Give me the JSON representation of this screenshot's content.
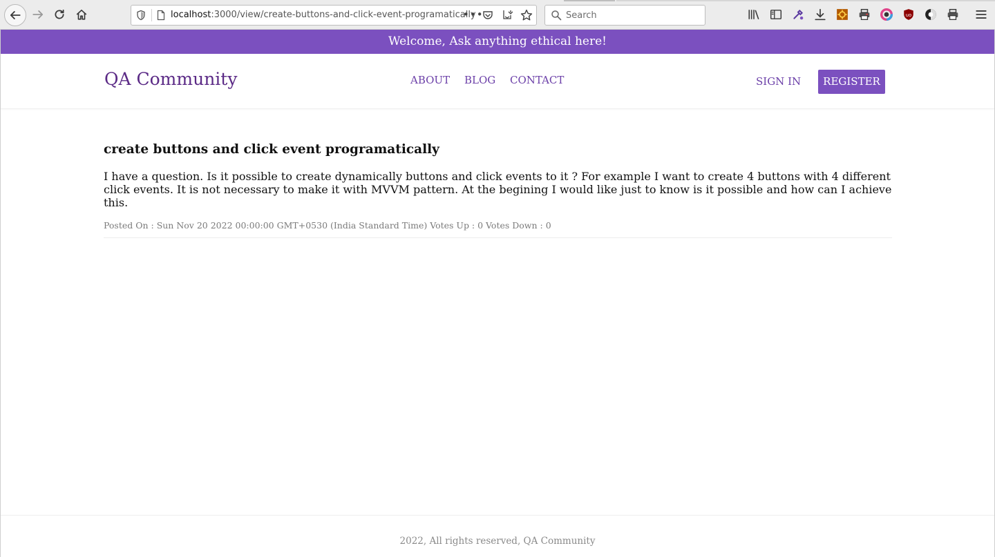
{
  "browser": {
    "url_host": "localhost",
    "url_rest": ":3000/view/create-buttons-and-click-event-programatically",
    "more_label": "•••",
    "search_placeholder": "Search"
  },
  "banner": {
    "text": "Welcome, Ask anything ethical here!"
  },
  "header": {
    "brand": "QA Community",
    "nav": {
      "about": "ABOUT",
      "blog": "BLOG",
      "contact": "CONTACT"
    },
    "sign_in": "SIGN IN",
    "register": "REGISTER"
  },
  "post": {
    "title": "create buttons and click event programatically",
    "body": "I have a question. Is it possible to create dynamically buttons and click events to it ? For example I want to create 4 buttons with 4 different click events. It is not necessary to make it with MVVM pattern. At the begining I would like just to know is it possible and how can I achieve this.",
    "meta": "Posted On : Sun Nov 20 2022 00:00:00 GMT+0530 (India Standard Time) Votes Up : 0 Votes Down : 0"
  },
  "footer": {
    "text": "2022, All rights reserved, QA Community"
  },
  "colors": {
    "accent": "#7b50bf",
    "brand": "#5b2a86",
    "link": "#6b3fa8"
  }
}
